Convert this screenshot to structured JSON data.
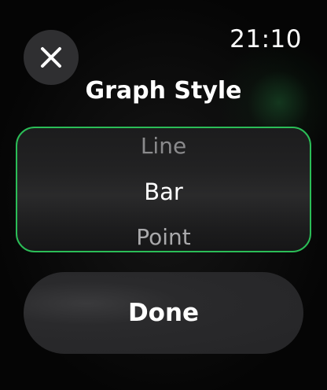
{
  "status_bar": {
    "time": "21:10"
  },
  "header": {
    "title": "Graph Style"
  },
  "picker": {
    "previous": "Line",
    "selected": "Bar",
    "next": "Point"
  },
  "actions": {
    "done_label": "Done"
  },
  "icons": {
    "close": "close-icon"
  },
  "colors": {
    "accent": "#2bbd57",
    "button_bg": "#2f2f31",
    "background": "#000000"
  }
}
